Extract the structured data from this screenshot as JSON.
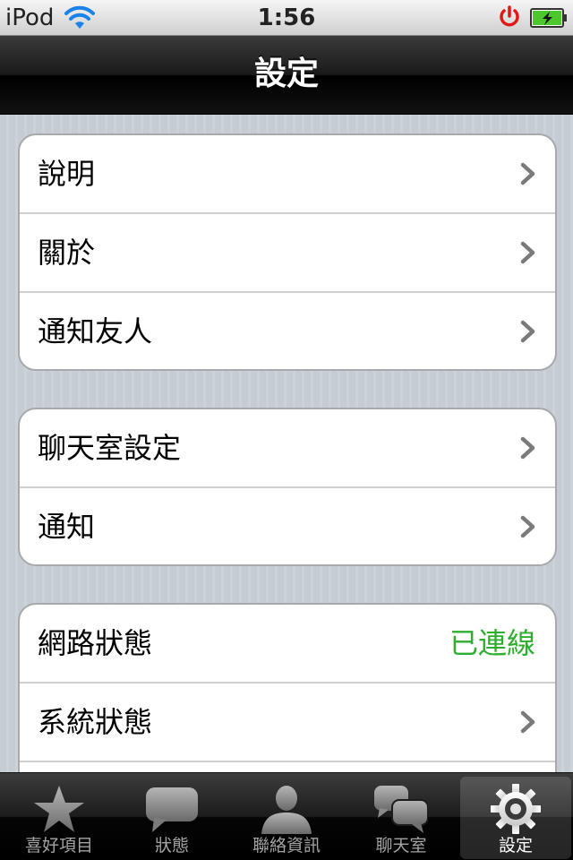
{
  "status_bar": {
    "carrier": "iPod",
    "time": "1:56"
  },
  "nav": {
    "title": "設定"
  },
  "groups": [
    {
      "rows": [
        {
          "label": "說明"
        },
        {
          "label": "關於"
        },
        {
          "label": "通知友人"
        }
      ]
    },
    {
      "rows": [
        {
          "label": "聊天室設定"
        },
        {
          "label": "通知"
        }
      ]
    },
    {
      "rows": [
        {
          "label": "網路狀態",
          "value": "已連線"
        },
        {
          "label": "系統狀態"
        }
      ]
    }
  ],
  "tabs": [
    {
      "label": "喜好項目",
      "icon": "star-icon"
    },
    {
      "label": "狀態",
      "icon": "speech-bubble-icon"
    },
    {
      "label": "聯絡資訊",
      "icon": "person-icon"
    },
    {
      "label": "聊天室",
      "icon": "chat-bubbles-icon"
    },
    {
      "label": "設定",
      "icon": "gear-icon",
      "selected": true
    }
  ],
  "colors": {
    "status_value": "#2fad2f",
    "tab_selected_label": "#ffffff",
    "tab_label": "#a3a3a3"
  }
}
